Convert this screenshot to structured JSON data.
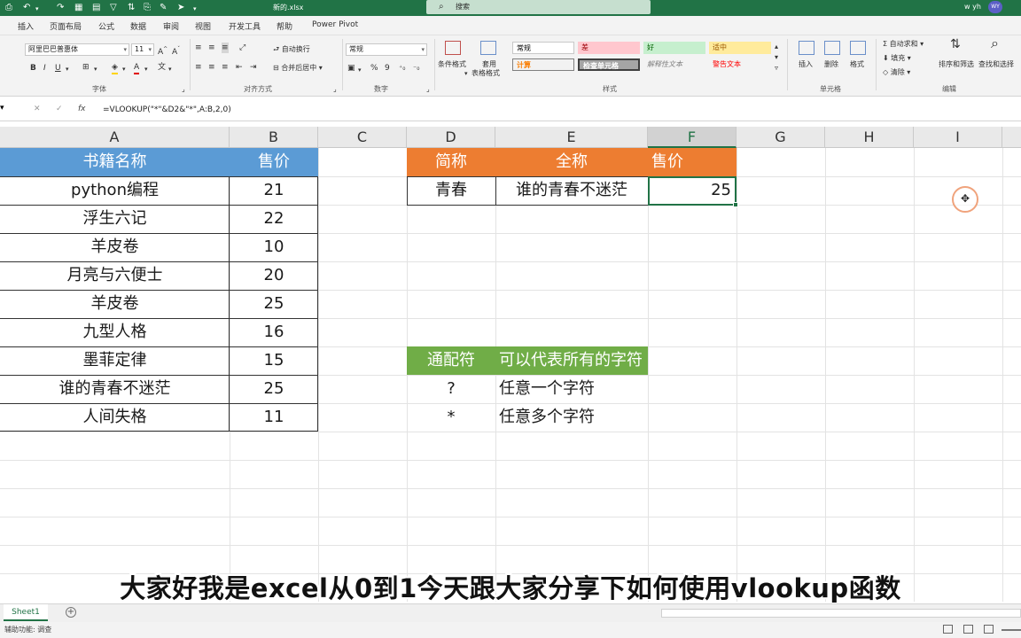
{
  "window": {
    "filename": "新的.xlsx",
    "search_placeholder": "搜索",
    "user": "w yh",
    "avatar": "WY"
  },
  "tabs": [
    "插入",
    "页面布局",
    "公式",
    "数据",
    "审阅",
    "视图",
    "开发工具",
    "帮助",
    "Power Pivot"
  ],
  "ribbon": {
    "font": {
      "name": "阿里巴巴普惠体",
      "size": "11",
      "group_label": "字体"
    },
    "alignment": {
      "wrap": "自动换行",
      "merge": "合并后居中",
      "group_label": "对齐方式"
    },
    "number": {
      "format": "常规",
      "group_label": "数字",
      "percent": "%",
      "comma": "9"
    },
    "styles": {
      "conditional": "条件格式",
      "table_format_1": "套用",
      "table_format_2": "表格格式",
      "cells": [
        "常规",
        "差",
        "好",
        "适中",
        "计算",
        "检查单元格",
        "解释性文本",
        "警告文本"
      ],
      "group_label": "样式"
    },
    "cells": {
      "insert": "插入",
      "delete": "删除",
      "format": "格式",
      "group_label": "单元格"
    },
    "editing": {
      "autosum": "自动求和",
      "fill": "填充",
      "clear": "清除",
      "sort": "排序和筛选",
      "find": "查找和选择",
      "group_label": "编辑"
    }
  },
  "formula_bar": {
    "formula": "=VLOOKUP(\"*\"&D2&\"*\",A:B,2,0)",
    "cancel": "✕",
    "confirm": "✓",
    "fx": "fx"
  },
  "columns": [
    "A",
    "B",
    "C",
    "D",
    "E",
    "F",
    "G",
    "H",
    "I"
  ],
  "selected_column": "F",
  "books_table": {
    "headers": [
      "书籍名称",
      "售价"
    ],
    "rows": [
      [
        "python编程",
        "21"
      ],
      [
        "浮生六记",
        "22"
      ],
      [
        "羊皮卷",
        "10"
      ],
      [
        "月亮与六便士",
        "20"
      ],
      [
        "羊皮卷",
        "25"
      ],
      [
        "九型人格",
        "16"
      ],
      [
        "墨菲定律",
        "15"
      ],
      [
        "谁的青春不迷茫",
        "25"
      ],
      [
        "人间失格",
        "11"
      ]
    ]
  },
  "lookup_table": {
    "headers": [
      "简称",
      "全称",
      "售价"
    ],
    "row": [
      "青春",
      "谁的青春不迷茫",
      "25"
    ]
  },
  "wildcard_table": {
    "headers": [
      "通配符",
      "可以代表所有的字符"
    ],
    "rows": [
      [
        "?",
        "任意一个字符"
      ],
      [
        "*",
        "任意多个字符"
      ]
    ]
  },
  "subtitle": "大家好我是excel从0到1今天跟大家分享下如何使用vlookup函数",
  "sheets": [
    "Sheet1"
  ],
  "status": "辅助功能: 调查",
  "colors": {
    "excel_green": "#217346",
    "blue_header": "#5b9bd5",
    "orange_header": "#ed7d31",
    "green_header": "#70ad47"
  }
}
